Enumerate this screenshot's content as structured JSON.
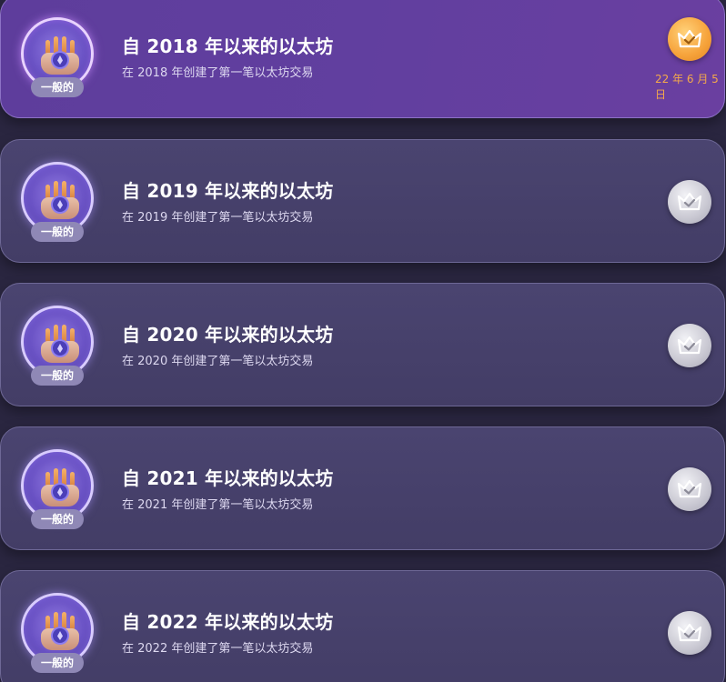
{
  "achievements": [
    {
      "title": "自 2018 年以来的以太坊",
      "subtitle": "在 2018 年创建了第一笔以太坊交易",
      "badge_label": "一般的",
      "status": "achieved",
      "date": "22 年 6 月 5 日",
      "crown_color": "#f6a23a",
      "icons": {
        "badge": "eth-cake-badge-icon",
        "status": "crown-check-icon"
      }
    },
    {
      "title": "自 2019 年以来的以太坊",
      "subtitle": "在 2019 年创建了第一笔以太坊交易",
      "badge_label": "一般的",
      "status": "locked",
      "crown_color": "#c9c8d2",
      "icons": {
        "badge": "eth-cake-badge-icon",
        "status": "crown-check-icon"
      }
    },
    {
      "title": "自 2020 年以来的以太坊",
      "subtitle": "在 2020 年创建了第一笔以太坊交易",
      "badge_label": "一般的",
      "status": "locked",
      "crown_color": "#c9c8d2",
      "icons": {
        "badge": "eth-cake-badge-icon",
        "status": "crown-check-icon"
      }
    },
    {
      "title": "自 2021 年以来的以太坊",
      "subtitle": "在 2021 年创建了第一笔以太坊交易",
      "badge_label": "一般的",
      "status": "locked",
      "crown_color": "#c9c8d2",
      "icons": {
        "badge": "eth-cake-badge-icon",
        "status": "crown-check-icon"
      }
    },
    {
      "title": "自 2022 年以来的以太坊",
      "subtitle": "在 2022 年创建了第一笔以太坊交易",
      "badge_label": "一般的",
      "status": "locked",
      "crown_color": "#c9c8d2",
      "icons": {
        "badge": "eth-cake-badge-icon",
        "status": "crown-check-icon"
      }
    }
  ]
}
